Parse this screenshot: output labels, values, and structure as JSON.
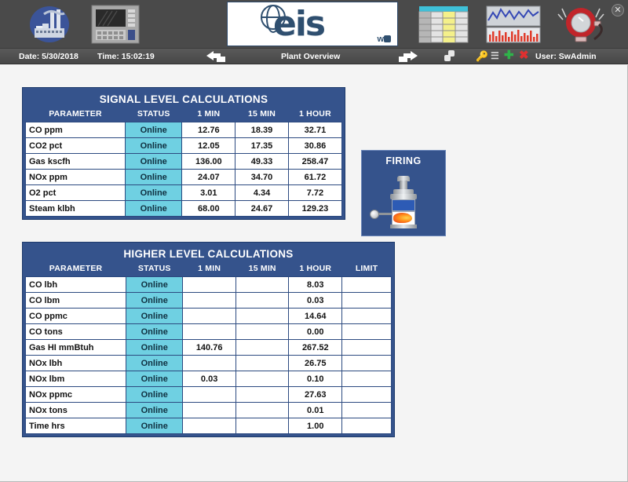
{
  "window": {
    "close_label": "✕"
  },
  "toolbar": {
    "buttons": [
      {
        "name": "plant-overview",
        "icon": "plant-icon",
        "label": "Plant Overview"
      },
      {
        "name": "control-panel",
        "icon": "control-panel-icon",
        "label": "Control Panel"
      },
      {
        "name": "eis-logo",
        "icon": "eis-logo-icon",
        "label": "eis"
      },
      {
        "name": "reports-table",
        "icon": "table-report-icon",
        "label": "Reports"
      },
      {
        "name": "trends",
        "icon": "trend-chart-icon",
        "label": "Trends"
      },
      {
        "name": "alarms",
        "icon": "alarm-bell-icon",
        "label": "Alarms"
      }
    ],
    "logo_text": "eis",
    "logo_sub": "w"
  },
  "statusbar": {
    "date_label": "Date: 5/30/2018",
    "time_label": "Time: 15:02:19",
    "screen_title": "Plant Overview",
    "user_label": "User: SwAdmin",
    "icons": [
      "back-arrow-icon",
      "forward-arrow-icon",
      "link-nodes-icon",
      "key-icon",
      "brush-icon",
      "plus-icon",
      "close-x-icon"
    ]
  },
  "colors": {
    "panel_blue": "#35538c",
    "status_cyan": "#6fd0e2",
    "toolbar_gray": "#4a4a4a",
    "content_bg": "#f4f4f4",
    "grid_border": "#2c4a80"
  },
  "signal_table": {
    "title": "SIGNAL LEVEL CALCULATIONS",
    "columns": [
      "PARAMETER",
      "STATUS",
      "1 MIN",
      "15 MIN",
      "1 HOUR"
    ],
    "rows": [
      {
        "parameter": "CO ppm",
        "status": "Online",
        "min1": "12.76",
        "min15": "18.39",
        "hour1": "32.71"
      },
      {
        "parameter": "CO2 pct",
        "status": "Online",
        "min1": "12.05",
        "min15": "17.35",
        "hour1": "30.86"
      },
      {
        "parameter": "Gas kscfh",
        "status": "Online",
        "min1": "136.00",
        "min15": "49.33",
        "hour1": "258.47"
      },
      {
        "parameter": "NOx ppm",
        "status": "Online",
        "min1": "24.07",
        "min15": "34.70",
        "hour1": "61.72"
      },
      {
        "parameter": "O2 pct",
        "status": "Online",
        "min1": "3.01",
        "min15": "4.34",
        "hour1": "7.72"
      },
      {
        "parameter": "Steam klbh",
        "status": "Online",
        "min1": "68.00",
        "min15": "24.67",
        "hour1": "129.23"
      }
    ]
  },
  "higher_table": {
    "title": "HIGHER LEVEL CALCULATIONS",
    "columns": [
      "PARAMETER",
      "STATUS",
      "1 MIN",
      "15 MIN",
      "1 HOUR",
      "LIMIT"
    ],
    "rows": [
      {
        "parameter": "CO lbh",
        "status": "Online",
        "min1": "",
        "min15": "",
        "hour1": "8.03",
        "limit": ""
      },
      {
        "parameter": "CO lbm",
        "status": "Online",
        "min1": "",
        "min15": "",
        "hour1": "0.03",
        "limit": ""
      },
      {
        "parameter": "CO ppmc",
        "status": "Online",
        "min1": "",
        "min15": "",
        "hour1": "14.64",
        "limit": ""
      },
      {
        "parameter": "CO tons",
        "status": "Online",
        "min1": "",
        "min15": "",
        "hour1": "0.00",
        "limit": ""
      },
      {
        "parameter": "Gas HI mmBtuh",
        "status": "Online",
        "min1": "140.76",
        "min15": "",
        "hour1": "267.52",
        "limit": ""
      },
      {
        "parameter": "NOx lbh",
        "status": "Online",
        "min1": "",
        "min15": "",
        "hour1": "26.75",
        "limit": ""
      },
      {
        "parameter": "NOx lbm",
        "status": "Online",
        "min1": "0.03",
        "min15": "",
        "hour1": "0.10",
        "limit": ""
      },
      {
        "parameter": "NOx ppmc",
        "status": "Online",
        "min1": "",
        "min15": "",
        "hour1": "27.63",
        "limit": ""
      },
      {
        "parameter": "NOx tons",
        "status": "Online",
        "min1": "",
        "min15": "",
        "hour1": "0.01",
        "limit": ""
      },
      {
        "parameter": "Time hrs",
        "status": "Online",
        "min1": "",
        "min15": "",
        "hour1": "1.00",
        "limit": ""
      }
    ]
  },
  "firing_panel": {
    "title": "FIRING",
    "icon": "burner-flame-icon"
  }
}
